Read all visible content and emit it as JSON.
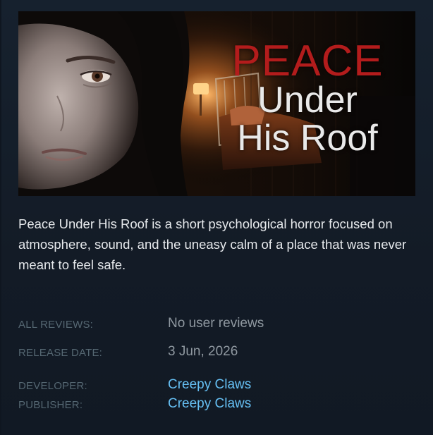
{
  "capsule": {
    "title_line_1": "PEACE",
    "title_line_2": "Under",
    "title_line_3": "His Roof"
  },
  "description": "Peace Under His Roof is a short psychological horror focused on atmosphere, sound, and the uneasy calm of a place that was never meant to feel safe.",
  "details": {
    "reviews_label": "ALL REVIEWS:",
    "reviews_value": "No user reviews",
    "release_label": "RELEASE DATE:",
    "release_value": "3 Jun, 2026",
    "developer_label": "DEVELOPER:",
    "developer_value": "Creepy Claws",
    "publisher_label": "PUBLISHER:",
    "publisher_value": "Creepy Claws"
  },
  "colors": {
    "background": "#16202d",
    "label": "#556772",
    "value": "#8f98a0",
    "link": "#66c0f4",
    "title_red": "#b31c1c"
  }
}
